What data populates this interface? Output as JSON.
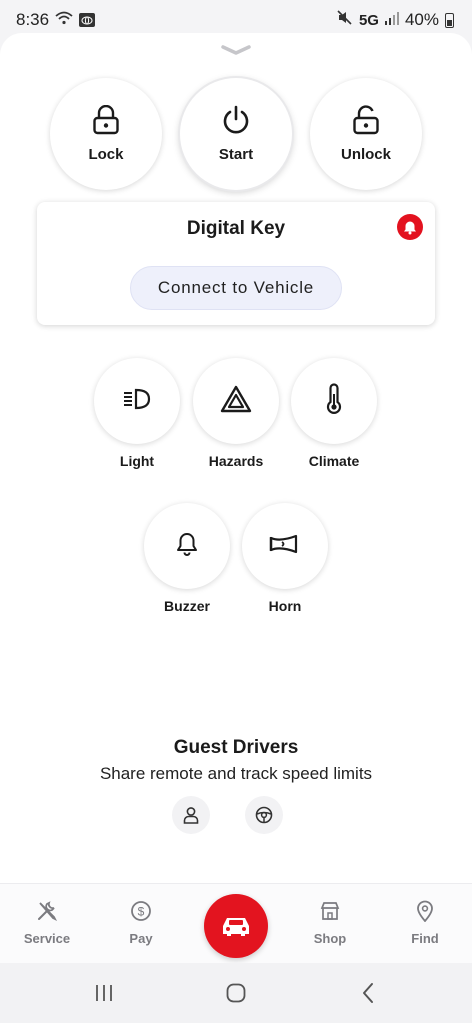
{
  "status_bar": {
    "time": "8:36",
    "network": "5G",
    "battery": "40%",
    "icons": [
      "wifi-icon",
      "toyota-app-icon",
      "mute-icon",
      "signal-icon",
      "battery-icon"
    ]
  },
  "sheet": {
    "handle_icon": "chevron-down-icon"
  },
  "controls": {
    "lock_label": "Lock",
    "start_label": "Start",
    "unlock_label": "Unlock"
  },
  "digital_key": {
    "title": "Digital Key",
    "connect_label": "Connect to Vehicle",
    "alert_icon": "bell-icon",
    "alert_color": "#e3121f"
  },
  "features": {
    "light": "Light",
    "hazards": "Hazards",
    "climate": "Climate",
    "buzzer": "Buzzer",
    "horn": "Horn"
  },
  "guest": {
    "title": "Guest Drivers",
    "subtitle": "Share remote and track speed limits",
    "icons": [
      "driver-icon",
      "steering-wheel-icon"
    ]
  },
  "nav": {
    "service": "Service",
    "pay": "Pay",
    "shop": "Shop",
    "find": "Find",
    "center_icon": "car-icon",
    "accent": "#e3141f"
  }
}
